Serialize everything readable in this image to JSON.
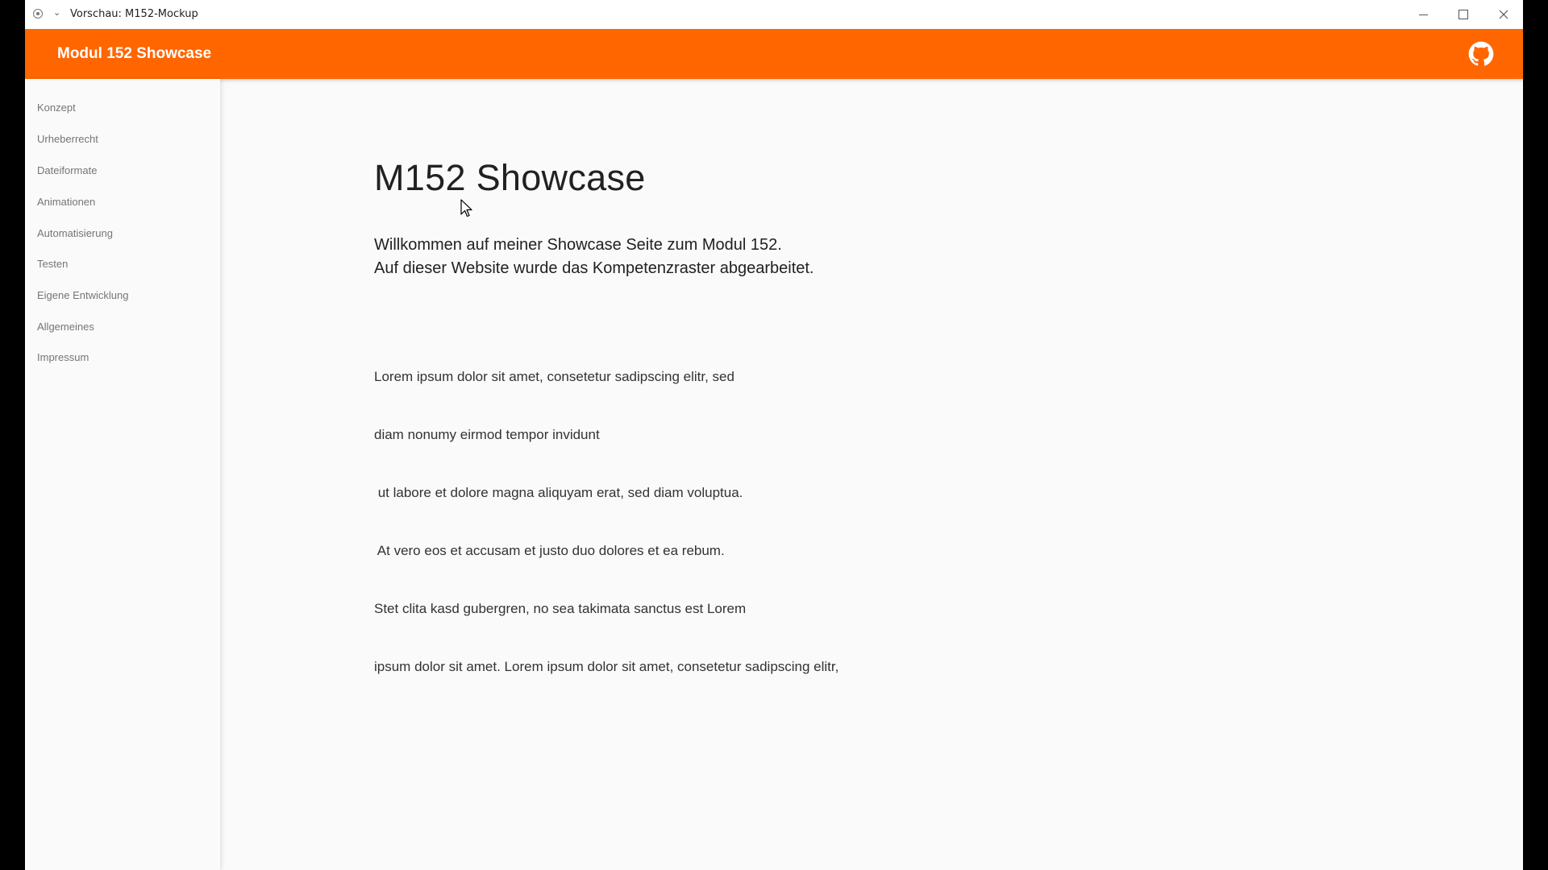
{
  "window": {
    "title": "Vorschau: M152-Mockup"
  },
  "appbar": {
    "title": "Modul 152 Showcase",
    "color": "#ff6600",
    "github_icon": "github-icon"
  },
  "sidebar": {
    "items": [
      {
        "label": "Konzept"
      },
      {
        "label": "Urheberrecht"
      },
      {
        "label": "Dateiformate"
      },
      {
        "label": "Animationen"
      },
      {
        "label": "Automatisierung"
      },
      {
        "label": "Testen"
      },
      {
        "label": "Eigene Entwicklung"
      },
      {
        "label": "Allgemeines"
      },
      {
        "label": "Impressum"
      }
    ]
  },
  "main": {
    "heading": "M152 Showcase",
    "intro": [
      "Willkommen auf meiner Showcase Seite zum Modul 152.",
      "Auf dieser Website wurde das Kompetenzraster abgearbeitet."
    ],
    "lorem": [
      "Lorem ipsum dolor sit amet, consetetur sadipscing elitr, sed",
      "diam nonumy eirmod tempor invidunt",
      " ut labore et dolore magna aliquyam erat, sed diam voluptua.",
      " At vero eos et accusam et justo duo dolores et ea rebum.",
      "Stet clita kasd gubergren, no sea takimata sanctus est Lorem",
      "ipsum dolor sit amet. Lorem ipsum dolor sit amet, consetetur sadipscing elitr,"
    ]
  }
}
